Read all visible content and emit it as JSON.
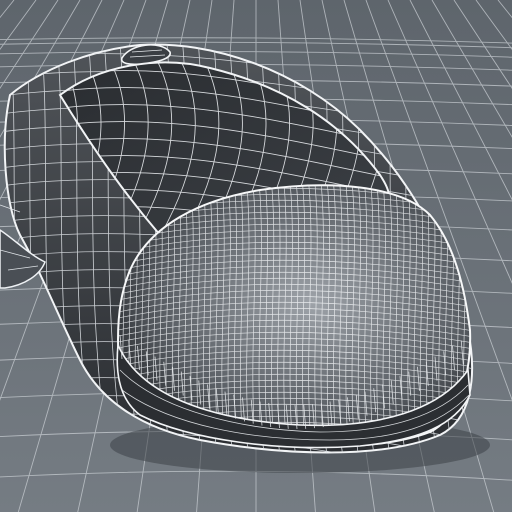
{
  "scene": {
    "subject": "wireframe-computer-mouse",
    "palette": {
      "floor": "#6f767d",
      "floor_far": "#5f666d",
      "floor_grid": "#c9ced3",
      "body_dark": "#2f3236",
      "body_mid": "#45494e",
      "body_light": "#8d9298",
      "wire": "#f2f4f6",
      "wire_dim": "#cfd4d9"
    }
  }
}
